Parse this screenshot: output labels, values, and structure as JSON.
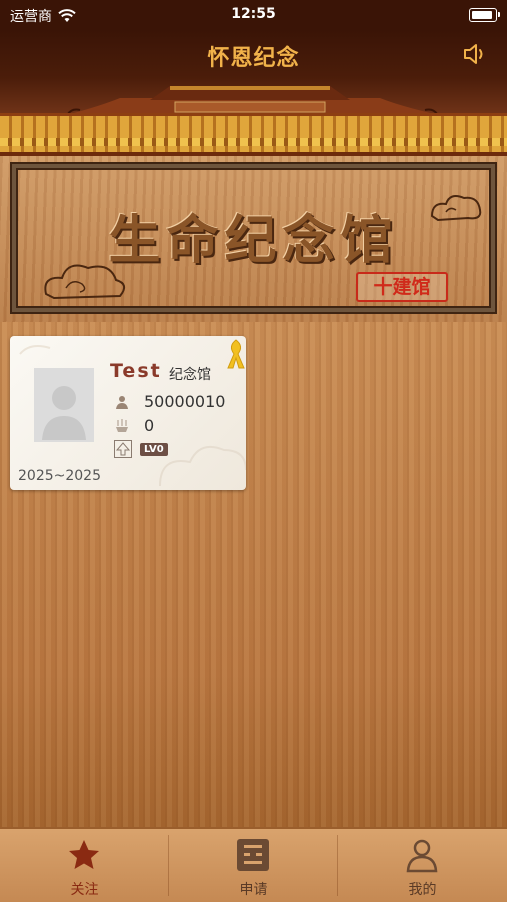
{
  "status_bar": {
    "carrier": "运营商",
    "time": "12:55"
  },
  "nav": {
    "title": "怀恩纪念"
  },
  "board": {
    "title": "生命纪念馆",
    "build_label": "十建馆"
  },
  "card": {
    "name": "Test",
    "suffix": "纪念馆",
    "id_number": "50000010",
    "offering_count": "0",
    "level": "LV0",
    "years": "2025~2025"
  },
  "tabs": [
    {
      "label": "关注",
      "icon": "star-icon",
      "active": true
    },
    {
      "label": "申请",
      "icon": "application-icon",
      "active": false
    },
    {
      "label": "我的",
      "icon": "person-icon",
      "active": false
    }
  ],
  "colors": {
    "nav_bg": "#3a1406",
    "nav_title": "#f1b24a",
    "build_red": "#c82a1a",
    "tab_active": "#8a2a12"
  }
}
